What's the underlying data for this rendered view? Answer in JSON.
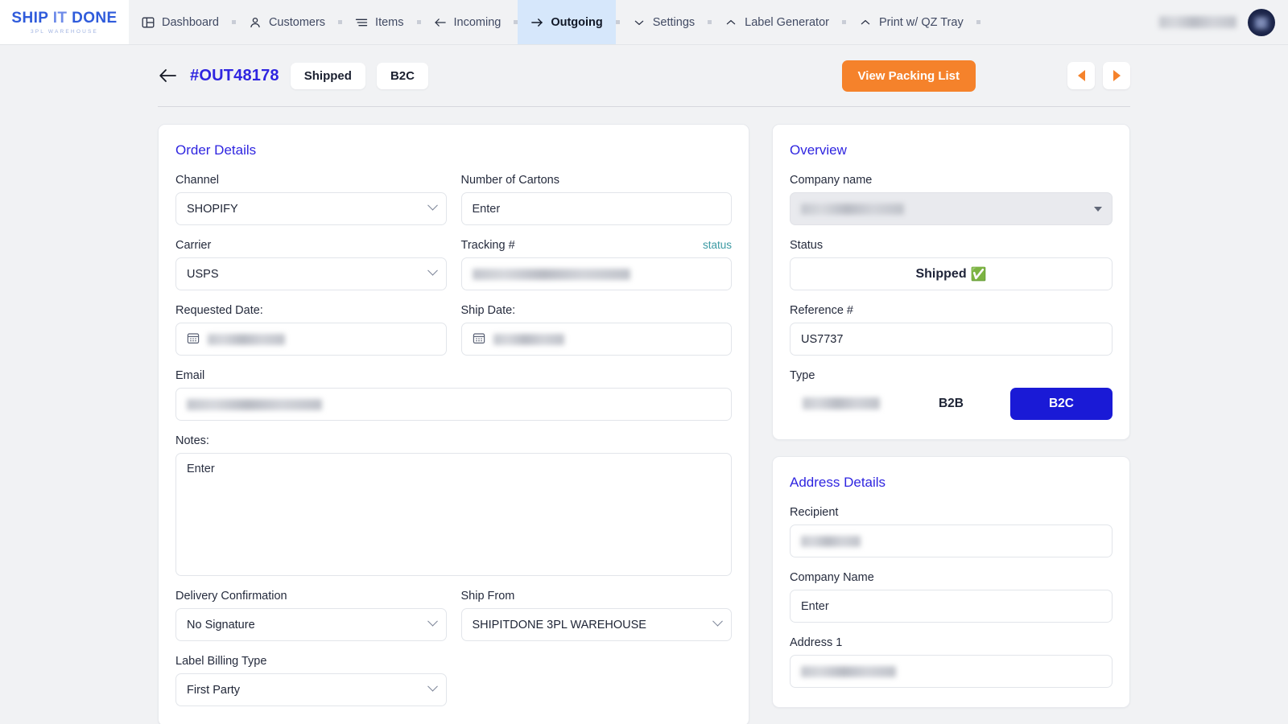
{
  "brand": {
    "line1_a": "SHIP",
    "line1_b": "IT",
    "line1_c": "DONE",
    "tagline": "3PL WAREHOUSE"
  },
  "nav": {
    "items": [
      {
        "label": "Dashboard",
        "icon": "layout-icon",
        "active": false
      },
      {
        "label": "Customers",
        "icon": "user-icon",
        "active": false
      },
      {
        "label": "Items",
        "icon": "list-icon",
        "active": false
      },
      {
        "label": "Incoming",
        "icon": "arrow-left-icon",
        "active": false
      },
      {
        "label": "Outgoing",
        "icon": "arrow-right-icon",
        "active": true
      },
      {
        "label": "Settings",
        "icon": "chevron-down-icon",
        "active": false
      },
      {
        "label": "Label Generator",
        "icon": "chevron-up-icon",
        "active": false
      },
      {
        "label": "Print w/ QZ Tray",
        "icon": "chevron-up-icon",
        "active": false
      }
    ],
    "user_name": "",
    "avatar_initials": ""
  },
  "order_header": {
    "back_icon": "arrow-left-icon",
    "order_id": "#OUT48178",
    "status_pill": "Shipped",
    "type_pill": "B2C",
    "packing_list_button": "View Packing List",
    "prev_icon": "triangle-left-icon",
    "next_icon": "triangle-right-icon"
  },
  "order_details": {
    "title": "Order Details",
    "channel_label": "Channel",
    "channel_value": "SHOPIFY",
    "cartons_label": "Number of Cartons",
    "cartons_placeholder": "Enter",
    "carrier_label": "Carrier",
    "carrier_value": "USPS",
    "tracking_label": "Tracking #",
    "tracking_status_link": "status",
    "tracking_value": "",
    "requested_date_label": "Requested Date:",
    "requested_date_value": "",
    "ship_date_label": "Ship Date:",
    "ship_date_value": "",
    "email_label": "Email",
    "email_value": "",
    "notes_label": "Notes:",
    "notes_placeholder": "Enter",
    "delivery_confirmation_label": "Delivery Confirmation",
    "delivery_confirmation_value": "No Signature",
    "ship_from_label": "Ship From",
    "ship_from_value": "SHIPITDONE 3PL WAREHOUSE",
    "label_billing_label": "Label Billing Type",
    "label_billing_value": "First Party"
  },
  "overview": {
    "title": "Overview",
    "company_label": "Company name",
    "company_value": "",
    "status_label": "Status",
    "status_value": "Shipped",
    "status_emoji": "✅",
    "reference_label": "Reference #",
    "reference_value": "US7737",
    "type_label": "Type",
    "type_options": [
      {
        "label": "",
        "redacted": true,
        "selected": false
      },
      {
        "label": "B2B",
        "redacted": false,
        "selected": false
      },
      {
        "label": "B2C",
        "redacted": false,
        "selected": true
      }
    ]
  },
  "address_details": {
    "title": "Address Details",
    "recipient_label": "Recipient",
    "recipient_value": "",
    "company_label": "Company Name",
    "company_placeholder": "Enter",
    "address1_label": "Address 1",
    "address1_value": ""
  },
  "colors": {
    "brand_blue": "#2f5bdb",
    "heading_blue": "#2f25e0",
    "accent_orange": "#f5822b",
    "nav_active_bg": "#d6e7fb",
    "selected_blue": "#1a1ad6",
    "status_link_teal": "#3c9aa3",
    "page_bg": "#f1f2f4"
  }
}
